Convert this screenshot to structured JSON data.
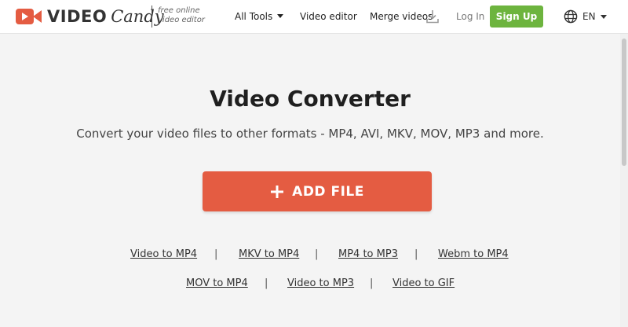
{
  "brand": {
    "logo_word_1": "VIDEO",
    "logo_word_2": "Candy",
    "tagline_line_1": "free online",
    "tagline_line_2": "video editor",
    "accent_color": "#e45c42"
  },
  "nav": {
    "all_tools": "All Tools",
    "video_editor": "Video editor",
    "merge_videos": "Merge videos",
    "download_icon": "download-icon",
    "login": "Log In",
    "signup": "Sign Up",
    "signup_color": "#6db43e",
    "language": "EN",
    "language_icon": "globe-icon"
  },
  "hero": {
    "title": "Video Converter",
    "subtitle": "Convert your video files to other formats - MP4, AVI, MKV, MOV, MP3 and more.",
    "add_file_label": "ADD FILE",
    "add_file_icon": "plus-icon"
  },
  "links": {
    "row_1": [
      "Video to MP4",
      "MKV to MP4",
      "MP4 to MP3",
      "Webm to MP4"
    ],
    "row_2": [
      "MOV to MP4",
      "Video to MP3",
      "Video to GIF"
    ],
    "separator": "|"
  }
}
